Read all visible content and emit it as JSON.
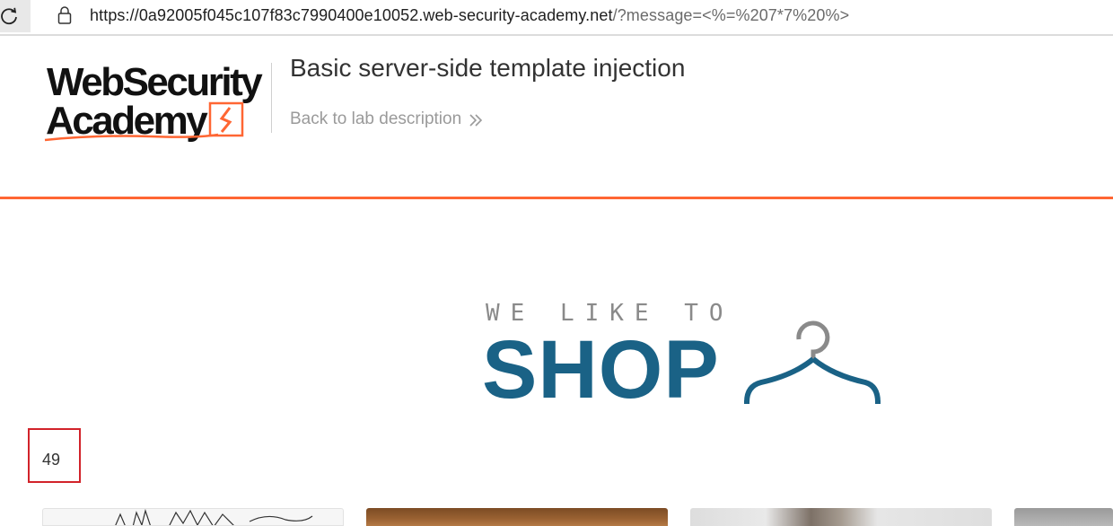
{
  "browser": {
    "url_host": "https://0a92005f045c107f83c7990400e10052.web-security-academy.net",
    "url_path": "/?message=<%=%207*7%20%>"
  },
  "header": {
    "logo_text": "WebSecurity Academy",
    "lab_title": "Basic server-side template injection",
    "back_link": "Back to lab description"
  },
  "banner": {
    "tagline": "WE LIKE TO",
    "shop_word": "SHOP"
  },
  "result": {
    "value": "49"
  },
  "products": {
    "count": 4
  },
  "colors": {
    "accent": "#ff6633",
    "shop_blue": "#1a6286",
    "highlight_box": "#d2232a"
  }
}
